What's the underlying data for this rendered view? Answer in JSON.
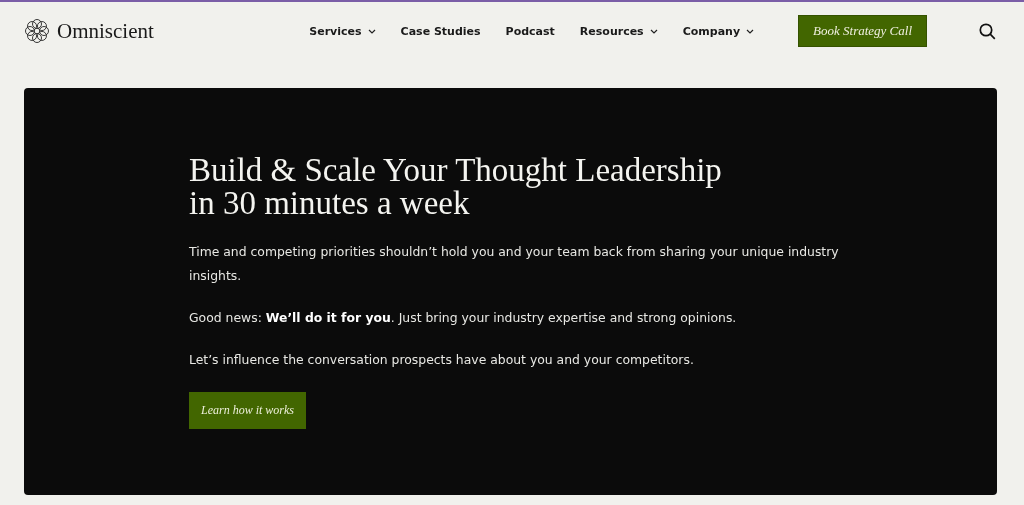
{
  "header": {
    "logo_text": "Omniscient",
    "nav": [
      {
        "label": "Services",
        "has_menu": true
      },
      {
        "label": "Case Studies",
        "has_menu": false
      },
      {
        "label": "Podcast",
        "has_menu": false
      },
      {
        "label": "Resources",
        "has_menu": true
      },
      {
        "label": "Company",
        "has_menu": true
      }
    ],
    "cta": "Book Strategy Call"
  },
  "hero": {
    "title_lines": [
      "Build & Scale Your Thought Leadership",
      "in 30 minutes a week"
    ],
    "paragraphs": [
      "Time and competing priorities shouldn’t hold you and your team back from sharing your unique industry insights.",
      "Good news: **We’ll do it for you**. Just bring your industry expertise and strong opinions.",
      "Let’s influence the conversation prospects have about you and your competitors."
    ],
    "button": "Learn how it works"
  }
}
